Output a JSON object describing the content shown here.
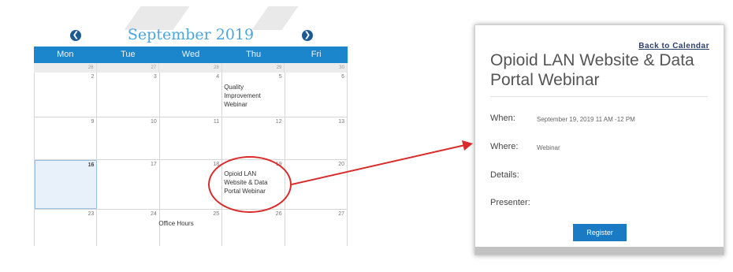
{
  "calendar": {
    "month_title": "September 2019",
    "prev_icon": "chevron-left-icon",
    "next_icon": "chevron-right-icon",
    "weekdays": [
      "Mon",
      "Tue",
      "Wed",
      "Thu",
      "Fri"
    ],
    "prev_week_dates": [
      "26",
      "27",
      "28",
      "29",
      "30"
    ],
    "weeks": [
      {
        "days": [
          {
            "num": "2"
          },
          {
            "num": "3"
          },
          {
            "num": "4"
          },
          {
            "num": "5",
            "event": [
              "Quality",
              "Improvement",
              "Webinar"
            ]
          },
          {
            "num": "6"
          }
        ]
      },
      {
        "days": [
          {
            "num": "9"
          },
          {
            "num": "10"
          },
          {
            "num": "11"
          },
          {
            "num": "12"
          },
          {
            "num": "13"
          }
        ]
      },
      {
        "days": [
          {
            "num": "16",
            "today": true
          },
          {
            "num": "17"
          },
          {
            "num": "18"
          },
          {
            "num": "19",
            "event": [
              "Opioid LAN",
              "Website & Data",
              "Portal Webinar"
            ]
          },
          {
            "num": "20"
          }
        ]
      },
      {
        "days": [
          {
            "num": "23"
          },
          {
            "num": "24",
            "event": [
              "Office Hours"
            ]
          },
          {
            "num": "25"
          },
          {
            "num": "26"
          },
          {
            "num": "27"
          }
        ]
      }
    ]
  },
  "annotation": {
    "color": "#d92b2b"
  },
  "detail": {
    "back_link": "Back to Calendar",
    "title": "Opioid LAN Website & Data Portal Webinar",
    "fields": [
      {
        "label": "When:",
        "value": "September 19, 2019 11 AM -12 PM"
      },
      {
        "label": "Where:",
        "value": "Webinar"
      },
      {
        "label": "Details:",
        "value": ""
      },
      {
        "label": "Presenter:",
        "value": ""
      }
    ],
    "register_label": "Register"
  },
  "colors": {
    "header_blue": "#1b86cc",
    "title_blue": "#4aa6dc",
    "nav_blue": "#1e5a92",
    "button_blue": "#1b7ac4"
  }
}
